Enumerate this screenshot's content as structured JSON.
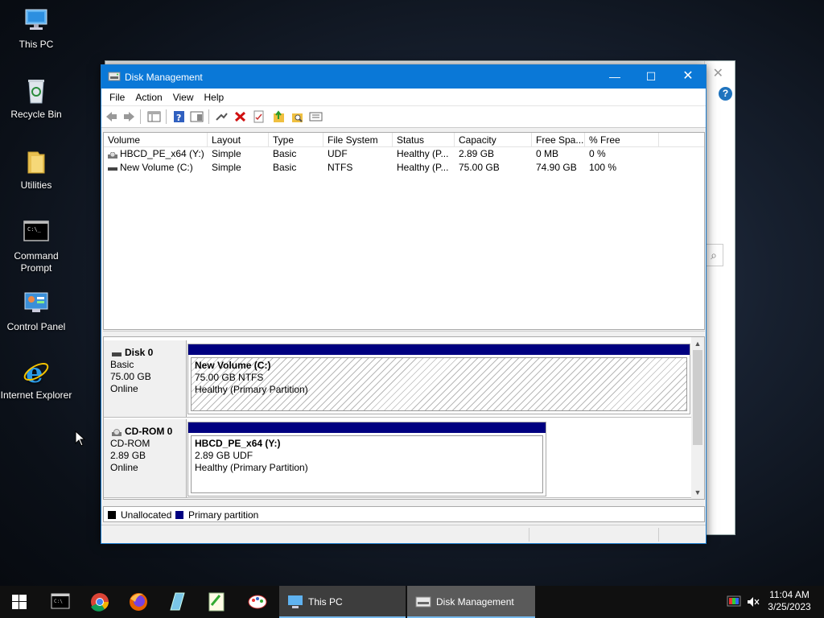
{
  "desktop": {
    "icons": [
      {
        "label": "This PC",
        "icon": "this-pc-icon"
      },
      {
        "label": "Recycle Bin",
        "icon": "recycle-bin-icon"
      },
      {
        "label": "Utilities",
        "icon": "folder-icon"
      },
      {
        "label": "Command Prompt",
        "icon": "command-prompt-icon"
      },
      {
        "label": "Control Panel",
        "icon": "control-panel-icon"
      },
      {
        "label": "Internet Explorer",
        "icon": "internet-explorer-icon"
      }
    ]
  },
  "window": {
    "title": "Disk Management",
    "menu": [
      "File",
      "Action",
      "View",
      "Help"
    ]
  },
  "volume_list": {
    "columns": [
      "Volume",
      "Layout",
      "Type",
      "File System",
      "Status",
      "Capacity",
      "Free Spa...",
      "% Free"
    ],
    "rows": [
      {
        "volume": "HBCD_PE_x64 (Y:)",
        "layout": "Simple",
        "type": "Basic",
        "fs": "UDF",
        "status": "Healthy (P...",
        "capacity": "2.89 GB",
        "free": "0 MB",
        "pct": "0 %"
      },
      {
        "volume": "New Volume (C:)",
        "layout": "Simple",
        "type": "Basic",
        "fs": "NTFS",
        "status": "Healthy (P...",
        "capacity": "75.00 GB",
        "free": "74.90 GB",
        "pct": "100 %"
      }
    ]
  },
  "disks": [
    {
      "name": "Disk 0",
      "kind": "Basic",
      "size": "75.00 GB",
      "state": "Online",
      "partition": {
        "title": "New Volume  (C:)",
        "detail": "75.00 GB NTFS",
        "status": "Healthy (Primary Partition)"
      }
    },
    {
      "name": "CD-ROM 0",
      "kind": "CD-ROM",
      "size": "2.89 GB",
      "state": "Online",
      "partition": {
        "title": "HBCD_PE_x64  (Y:)",
        "detail": "2.89 GB UDF",
        "status": "Healthy (Primary Partition)"
      }
    }
  ],
  "legend": {
    "unallocated": "Unallocated",
    "primary": "Primary partition"
  },
  "colors": {
    "primary_partition": "#000080",
    "titlebar": "#0a78d7",
    "unallocated": "#000000"
  },
  "taskbar": {
    "pinned": [
      "start-icon",
      "command-prompt-icon",
      "chrome-icon",
      "firefox-icon",
      "notepad-icon",
      "notepad-plus-icon",
      "paint-icon"
    ],
    "tasks": [
      {
        "label": "This PC",
        "icon": "this-pc-icon"
      },
      {
        "label": "Disk Management",
        "icon": "disk-management-icon"
      }
    ],
    "time": "11:04 AM",
    "date": "3/25/2023"
  }
}
